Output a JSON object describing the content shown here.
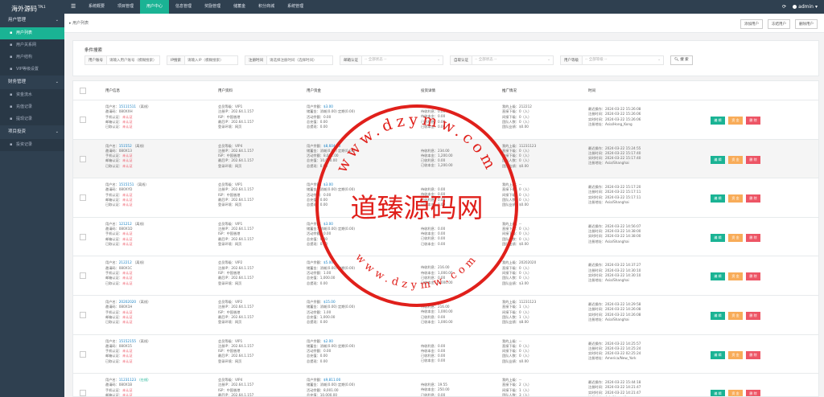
{
  "brand": {
    "name": "海外源码",
    "sup": "TPL1"
  },
  "nav": [
    "系统概要",
    "项目管理",
    "用户中心",
    "信息管理",
    "奖励管理",
    "储蓄金",
    "积分商城",
    "系统管理"
  ],
  "nav_active": 2,
  "header": {
    "user": "admin"
  },
  "sidebar": {
    "groups": [
      {
        "label": "用户管理",
        "items": [
          "用户列表",
          "用户关系网",
          "用户结构",
          "VIP等级设置"
        ]
      },
      {
        "label": "财务管理",
        "items": [
          "资金流水",
          "充值记录",
          "提现记录"
        ]
      },
      {
        "label": "项目投资",
        "items": [
          "投资记录"
        ]
      }
    ]
  },
  "breadcrumb": "用户列表",
  "top_buttons": [
    "添加用户",
    "冻结用户",
    "删除用户"
  ],
  "search": {
    "title": "条件搜索",
    "phone_label": "用户账号",
    "phone_ph": "请输入用户账号（模糊搜索）",
    "ip_label": "IP搜索",
    "ip_ph": "请输入IP（模糊搜索）",
    "time_label": "注册时间",
    "time_ph": "请选择注册时间（选择时间）",
    "email_label": "邮箱认证",
    "email_value": "-- 全部状态 --",
    "inviter_label": "自取认证",
    "inviter_value": "-- 全部状态 --",
    "level_label": "用户等级",
    "level_value": "-- 全部等级 --",
    "button": "搜 索"
  },
  "columns": [
    "用户信息",
    "用户资料",
    "用户资金",
    "投资详情",
    "推广情况",
    "时间"
  ],
  "actions": {
    "edit": "编 辑",
    "fund": "资 金",
    "del": "删 除"
  },
  "rows": [
    {
      "info": [
        "用户名：",
        "15111511",
        "（离线）",
        "邀请码：080XXH",
        "手机认证：",
        "未认证",
        "邮箱认证：",
        "未认证",
        "已取认证：",
        "未认证"
      ],
      "prof": [
        "会员等级：VIP1",
        "注册IP：202.64.1.157",
        "ISP：中国香港",
        "最后IP：202.64.1.157",
        "登录环境：网页"
      ],
      "fund": [
        "用户余额：",
        "$3.00",
        "储蓄金：消耗(0.00) 定期(0.00)",
        "活动余额：0.00",
        "总充值：0.00",
        "总提现：0.00"
      ],
      "inv": [
        "待收利息：0.00",
        "待收本金：0.00",
        "已收利息：0.00",
        "已收本金：0.00"
      ],
      "promo": [
        "我的上级：212212",
        "直接下级：0（人）",
        "间接下级：0（人）",
        "团队人数：0（人）",
        "团队业绩：$0.00"
      ],
      "time": [
        "最近操作：2024-03-22 15:26:08",
        "注册时间：2024-03-22 15:26:06",
        "实时时间：2024-03-22 15:26:06",
        "注册地址：Asia/Hong_Kong"
      ]
    },
    {
      "info": [
        "用户名：",
        "151552",
        "（离线）",
        "邀请码：080X13",
        "手机认证：",
        "未认证",
        "邮箱认证：",
        "未认证",
        "已取认证：",
        "未认证"
      ],
      "prof": [
        "会员等级：VIP4",
        "注册IP：202.64.1.157",
        "ISP：中国香港",
        "最后IP：202.64.1.157",
        "登录环境：网页"
      ],
      "fund": [
        "用户余额：",
        "$8,604.00",
        "储蓄金：消耗(0.00) 定期(0.00)",
        "活动余额：8,001.00",
        "总充值：10,000.00",
        "总提现：0.00"
      ],
      "inv": [
        "待收利息：234.00",
        "待收本金：1,200.00",
        "已收利息：0.00",
        "已收本金：1,200.00"
      ],
      "promo": [
        "我的上级：11231123",
        "直接下级：0（人）",
        "间接下级：0（人）",
        "团队人数：0（人）",
        "团队业绩：$0.00"
      ],
      "time": [
        "最近操作：2024-03-22 15:24:55",
        "注册时间：2024-03-22 15:17:40",
        "实时时间：2024-03-22 15:17:40",
        "注册地址：Asia/Shanghai"
      ]
    },
    {
      "info": [
        "用户名：",
        "1515151",
        "（离线）",
        "邀请码：080XYD",
        "手机认证：",
        "未认证",
        "邮箱认证：",
        "未认证",
        "已取认证：",
        "未认证"
      ],
      "prof": [
        "会员等级：VIP1",
        "注册IP：202.64.1.157",
        "ISP：中国香港",
        "最后IP：202.64.1.157",
        "登录环境：网页"
      ],
      "fund": [
        "用户余额：",
        "$3.00",
        "储蓄金：消耗(0.00) 定期(0.00)",
        "活动余额：0.00",
        "总充值：0.00",
        "总提现：0.00"
      ],
      "inv": [
        "待收利息：0.00",
        "待收本金：0.00",
        "已收利息：0.00",
        "已收本金：0.00"
      ],
      "promo": [
        "我的上级：--",
        "直接下级：0（人）",
        "间接下级：0（人）",
        "团队人数：0（人）",
        "团队业绩：$0.00"
      ],
      "time": [
        "最近操作：2024-03-22 15:17:20",
        "注册时间：2024-03-22 15:17:11",
        "实时时间：2024-03-22 15:17:11",
        "注册地址：Asia/Shanghai"
      ]
    },
    {
      "info": [
        "用户名：",
        "121212",
        "（离线）",
        "邀请码：080X1D",
        "手机认证：",
        "未认证",
        "邮箱认证：",
        "未认证",
        "已取认证：",
        "未认证"
      ],
      "prof": [
        "会员等级：VIP1",
        "注册IP：202.64.1.157",
        "ISP：中国香港",
        "最后IP：202.64.1.157",
        "登录环境：网页"
      ],
      "fund": [
        "用户余额：",
        "$3.00",
        "储蓄金：消耗(0.00) 定期(0.00)",
        "活动余额：0.00",
        "总充值：0.00",
        "总提现：0.00"
      ],
      "inv": [
        "待收利息：0.00",
        "待收本金：0.00",
        "已收利息：0.00",
        "已收本金：0.00"
      ],
      "promo": [
        "我的上级：--",
        "直接下级：0（人）",
        "间接下级：0（人）",
        "团队人数：0（人）",
        "团队业绩：$0.00"
      ],
      "time": [
        "最近操作：2024-03-22 14:56:07",
        "注册时间：2024-03-22 14:38:00",
        "实时时间：2024-03-22 14:38:00",
        "注册地址：Asia/Shanghai"
      ]
    },
    {
      "info": [
        "用户名：",
        "212212",
        "（离线）",
        "邀请码：080X1C",
        "手机认证：",
        "未认证",
        "邮箱认证：",
        "未认证",
        "已取认证：",
        "未认证"
      ],
      "prof": [
        "会员等级：VIP2",
        "注册IP：202.64.1.157",
        "ISP：中国香港",
        "最后IP：202.64.1.157",
        "登录环境：网页"
      ],
      "fund": [
        "用户余额：",
        "$5.00",
        "储蓄金：消耗(0.00) 定期(0.00)",
        "活动余额：1.00",
        "总充值：1,000.00",
        "总提现：0.00"
      ],
      "inv": [
        "待收利息：216.00",
        "待收本金：1,000.00",
        "已收利息：0.00",
        "已收本金：1,000.00"
      ],
      "promo": [
        "我的上级：20202020",
        "直接下级：0（人）",
        "间接下级：0（人）",
        "团队人数：0（人）",
        "团队业绩：$3.00"
      ],
      "time": [
        "最近操作：2024-03-22 14:37:27",
        "注册时间：2024-03-22 14:30:10",
        "实时时间：2024-03-22 14:30:10",
        "注册地址：Asia/Shanghai"
      ]
    },
    {
      "info": [
        "用户名：",
        "20202020",
        "（离线）",
        "邀请码：080X1H",
        "手机认证：",
        "未认证",
        "邮箱认证：",
        "未认证",
        "已取认证：",
        "未认证"
      ],
      "prof": [
        "会员等级：VIP2",
        "注册IP：202.64.1.157",
        "ISP：中国香港",
        "最后IP：202.64.1.157",
        "登录环境：网页"
      ],
      "fund": [
        "用户余额：",
        "$15.00",
        "储蓄金：消耗(0.00) 定期(0.00)",
        "活动余额：1.00",
        "总充值：1,000.00",
        "总提现：0.00"
      ],
      "inv": [
        "待收利息：216.00",
        "待收本金：1,000.00",
        "已收利息：0.00",
        "已收本金：1,000.00"
      ],
      "promo": [
        "我的上级：11231123",
        "直接下级：1（人）",
        "间接下级：0（人）",
        "团队人数：1（人）",
        "团队业绩：$8.00"
      ],
      "time": [
        "最近操作：2024-03-22 14:29:58",
        "注册时间：2024-03-22 14:26:08",
        "实时时间：2024-03-22 14:26:08",
        "注册地址：Asia/Shanghai"
      ]
    },
    {
      "info": [
        "用户名：",
        "15152155",
        "（离线）",
        "邀请码：080X15",
        "手机认证：",
        "未认证",
        "邮箱认证：",
        "未认证",
        "已取认证：",
        "未认证"
      ],
      "prof": [
        "会员等级：VIP1",
        "注册IP：202.64.1.157",
        "ISP：中国香港",
        "最后IP：202.64.1.157",
        "登录环境：网页"
      ],
      "fund": [
        "用户余额：",
        "$2.00",
        "储蓄金：消耗(0.00) 定期(0.00)",
        "活动余额：0.00",
        "总充值：0.00",
        "总提现：0.00"
      ],
      "inv": [
        "待收利息：0.00",
        "待收本金：0.00",
        "已收利息：0.00",
        "已收本金：0.00"
      ],
      "promo": [
        "我的上级：--",
        "直接下级：0（人）",
        "间接下级：0（人）",
        "团队人数：0（人）",
        "团队业绩：$0.00"
      ],
      "time": [
        "最近操作：2024-03-22 14:25:57",
        "注册时间：2024-03-22 14:25:24",
        "实时时间：2024-03-22 02:25:24",
        "注册地址：America/New_York"
      ]
    },
    {
      "info": [
        "用户名：",
        "11231123",
        "（在线）",
        "邀请码：080X1B",
        "手机认证：",
        "未认证",
        "邮箱认证：",
        "未认证",
        "已取认证：",
        "未认证"
      ],
      "prof": [
        "会员等级：VIP4",
        "注册IP：202.64.1.157",
        "ISP：中国香港",
        "最后IP：202.64.1.157",
        "登录环境：网页"
      ],
      "fund": [
        "用户余额：",
        "$9,811.00",
        "储蓄金：消耗(0.00) 定期(0.00)",
        "活动余额：8,001.00",
        "总充值：10,000.00",
        "总提现：0.00"
      ],
      "inv": [
        "待收利息：19.55",
        "待收本金：250.00",
        "已收利息：0.00",
        "已收本金：250.00"
      ],
      "promo": [
        "我的上级：--",
        "直接下级：2（人）",
        "间接下级：1（人）",
        "团队人数：3（人）",
        "团队业绩：$8,847.00"
      ],
      "time": [
        "最近操作：2024-03-22 15:44:18",
        "注册时间：2024-03-22 14:21:47",
        "实时时间：2024-03-22 14:21:47",
        "注册地址：Asia/Hong_Kong"
      ]
    }
  ],
  "watermark": {
    "text": "道臻源码网",
    "url_top": "www.dzymw.com",
    "url_bottom": "www.dzymw.com",
    "color": "#e0201b"
  }
}
